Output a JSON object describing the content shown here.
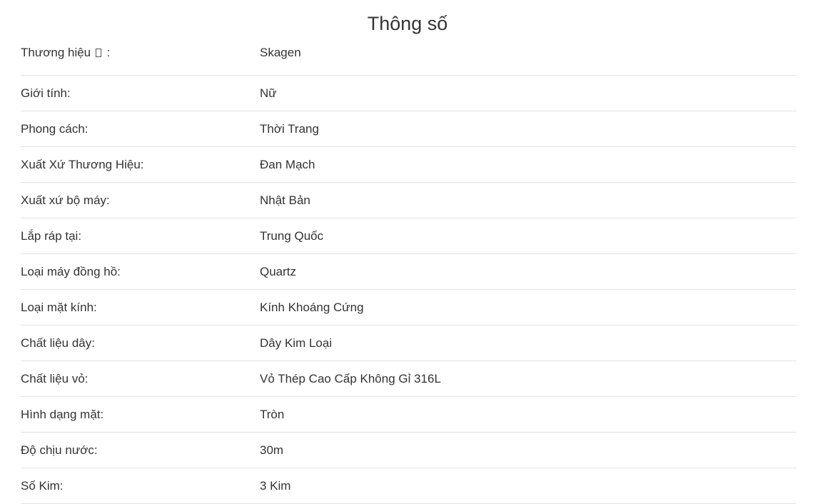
{
  "section": {
    "title": "Thông số"
  },
  "rows": [
    {
      "label": "Thương hiệu",
      "label_suffix": ":",
      "value": "Skagen"
    },
    {
      "label": "Giới tính:",
      "value": "Nữ"
    },
    {
      "label": "Phong cách:",
      "value": "Thời Trang"
    },
    {
      "label": "Xuất Xứ Thương Hiệu:",
      "value": "Đan Mạch"
    },
    {
      "label": "Xuất xứ bộ máy:",
      "value": "Nhật Bản"
    },
    {
      "label": "Lắp ráp tại:",
      "value": "Trung Quốc"
    },
    {
      "label": "Loại máy đồng hồ:",
      "value": "Quartz"
    },
    {
      "label": "Loại mặt kính:",
      "value": "Kính Khoáng Cứng"
    },
    {
      "label": "Chất liệu dây:",
      "value": "Dây Kim Loại"
    },
    {
      "label": "Chất liệu vỏ:",
      "value": "Vỏ Thép Cao Cấp Không Gỉ 316L"
    },
    {
      "label": "Hình dạng mặt:",
      "value": "Tròn"
    },
    {
      "label": "Độ chịu nước:",
      "value": "30m"
    },
    {
      "label": "Số Kim:",
      "value": "3 Kim"
    }
  ],
  "icons": {
    "brand_info": "info-box-icon"
  }
}
